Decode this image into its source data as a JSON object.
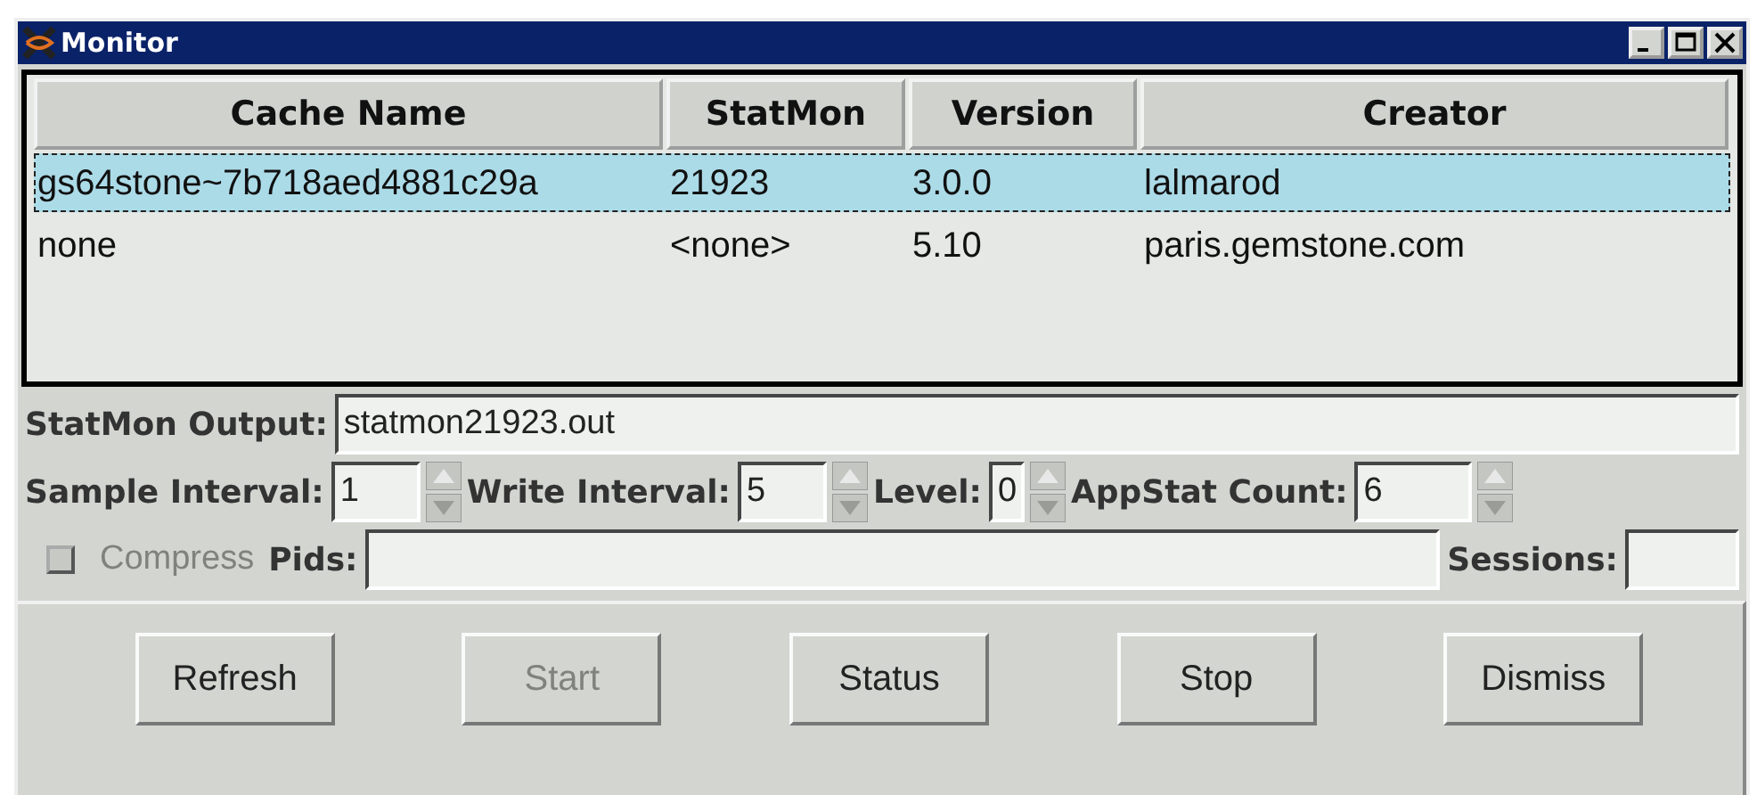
{
  "window": {
    "title": "Monitor"
  },
  "table": {
    "columns": [
      "Cache Name",
      "StatMon",
      "Version",
      "Creator"
    ],
    "rows": [
      {
        "cells": [
          "gs64stone~7b718aed4881c29a",
          "21923",
          "3.0.0",
          "lalmarod"
        ],
        "selected": true
      },
      {
        "cells": [
          "none",
          "<none>",
          "5.10",
          "paris.gemstone.com"
        ],
        "selected": false
      }
    ]
  },
  "statmon_output": {
    "label": "StatMon Output:",
    "value": "statmon21923.out"
  },
  "spinners": [
    {
      "label": "Sample Interval:",
      "value": "1"
    },
    {
      "label": "Write Interval:",
      "value": "5"
    },
    {
      "label": "Level:",
      "value": "0"
    },
    {
      "label": "AppStat Count:",
      "value": "6"
    }
  ],
  "compress": {
    "label": "Compress",
    "checked": false,
    "disabled": true
  },
  "pids": {
    "label": "Pids:"
  },
  "sessions": {
    "label": "Sessions:"
  },
  "buttons": [
    {
      "label": "Refresh",
      "disabled": false
    },
    {
      "label": "Start",
      "disabled": true
    },
    {
      "label": "Status",
      "disabled": false
    },
    {
      "label": "Stop",
      "disabled": false
    },
    {
      "label": "Dismiss",
      "disabled": false
    }
  ]
}
